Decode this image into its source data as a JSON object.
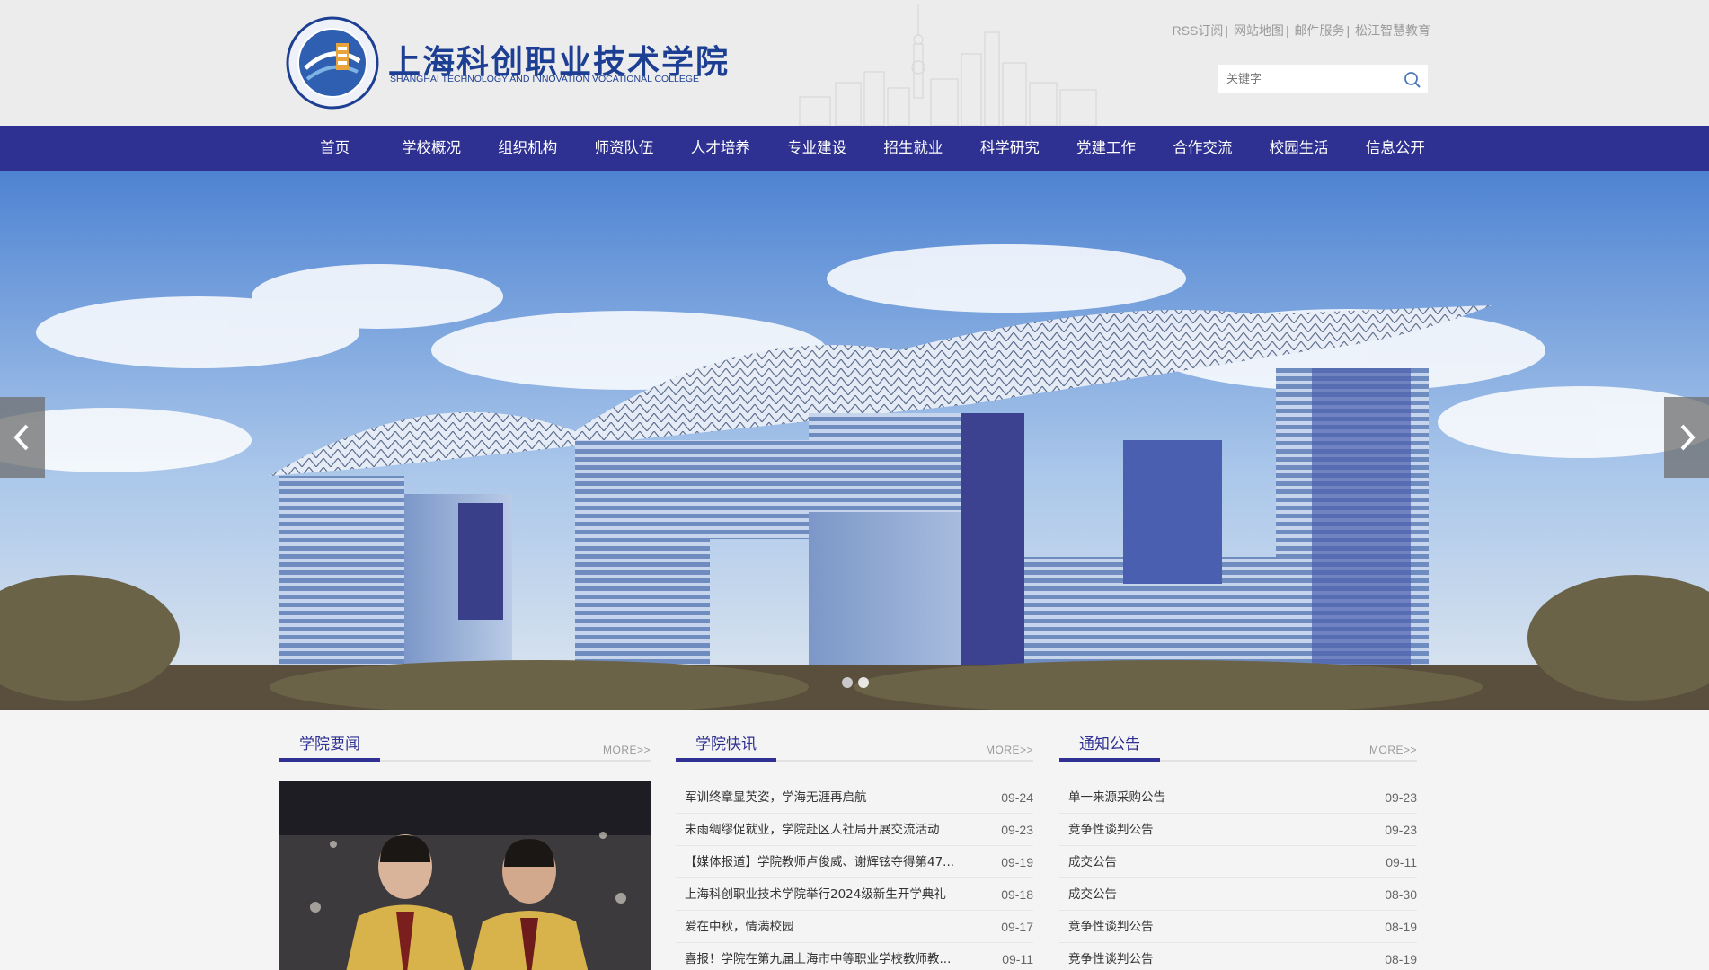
{
  "header": {
    "logo_cn": "上海科创职业技术学院",
    "logo_en": "SHANGHAI TECHNOLOGY AND INNOVATION VOCATIONAL COLLEGE",
    "top_links": [
      "RSS订阅",
      "网站地图",
      "邮件服务",
      "松江智慧教育"
    ],
    "search_placeholder": "关键字"
  },
  "nav": {
    "items": [
      "首页",
      "学校概况",
      "组织机构",
      "师资队伍",
      "人才培养",
      "专业建设",
      "招生就业",
      "科学研究",
      "党建工作",
      "合作交流",
      "校园生活",
      "信息公开"
    ]
  },
  "banner": {
    "slide_count": 2,
    "active_slide": 1
  },
  "sections": {
    "news": {
      "title": "学院要闻",
      "more": "MORE>>"
    },
    "flash": {
      "title": "学院快讯",
      "more": "MORE>>",
      "items": [
        {
          "title": "军训终章显英姿，学海无涯再启航",
          "date": "09-24"
        },
        {
          "title": "未雨绸缪促就业，学院赴区人社局开展交流活动",
          "date": "09-23"
        },
        {
          "title": "【媒体报道】学院教师卢俊威、谢辉铉夺得第47...",
          "date": "09-19"
        },
        {
          "title": "上海科创职业技术学院举行2024级新生开学典礼",
          "date": "09-18"
        },
        {
          "title": "爱在中秋，情满校园",
          "date": "09-17"
        },
        {
          "title": "喜报！学院在第九届上海市中等职业学校教师教...",
          "date": "09-11"
        }
      ]
    },
    "notices": {
      "title": "通知公告",
      "more": "MORE>>",
      "items": [
        {
          "title": "单一来源采购公告",
          "date": "09-23"
        },
        {
          "title": "竞争性谈判公告",
          "date": "09-23"
        },
        {
          "title": "成交公告",
          "date": "09-11"
        },
        {
          "title": "成交公告",
          "date": "08-30"
        },
        {
          "title": "竞争性谈判公告",
          "date": "08-19"
        },
        {
          "title": "竞争性谈判公告",
          "date": "08-19"
        }
      ]
    }
  },
  "colors": {
    "primary": "#2f3192",
    "logo_blue": "#1d3f93",
    "header_bg": "#ececec"
  }
}
